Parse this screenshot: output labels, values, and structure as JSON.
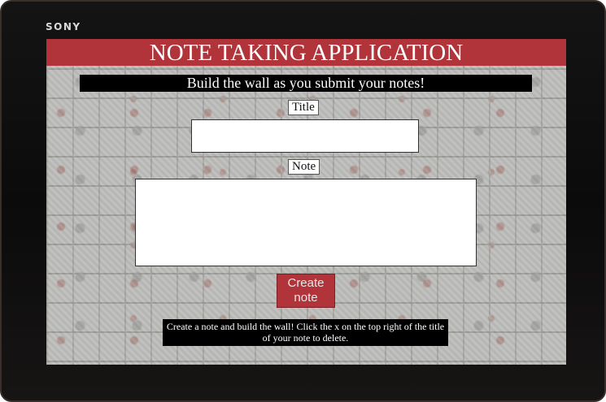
{
  "device": {
    "brand": "SONY"
  },
  "app": {
    "title": "NOTE TAKING APPLICATION",
    "subtitle": "Build the wall as you submit your notes!"
  },
  "form": {
    "title_label": "Title",
    "title_value": "",
    "note_label": "Note",
    "note_value": "",
    "create_button_label": "Create note"
  },
  "footer": {
    "instructions": "Create a note and build the wall! Click the x on the top right of the title of your note to delete."
  },
  "colors": {
    "accent": "#b0343a",
    "banner": "#000000",
    "text_light": "#ffffff"
  }
}
